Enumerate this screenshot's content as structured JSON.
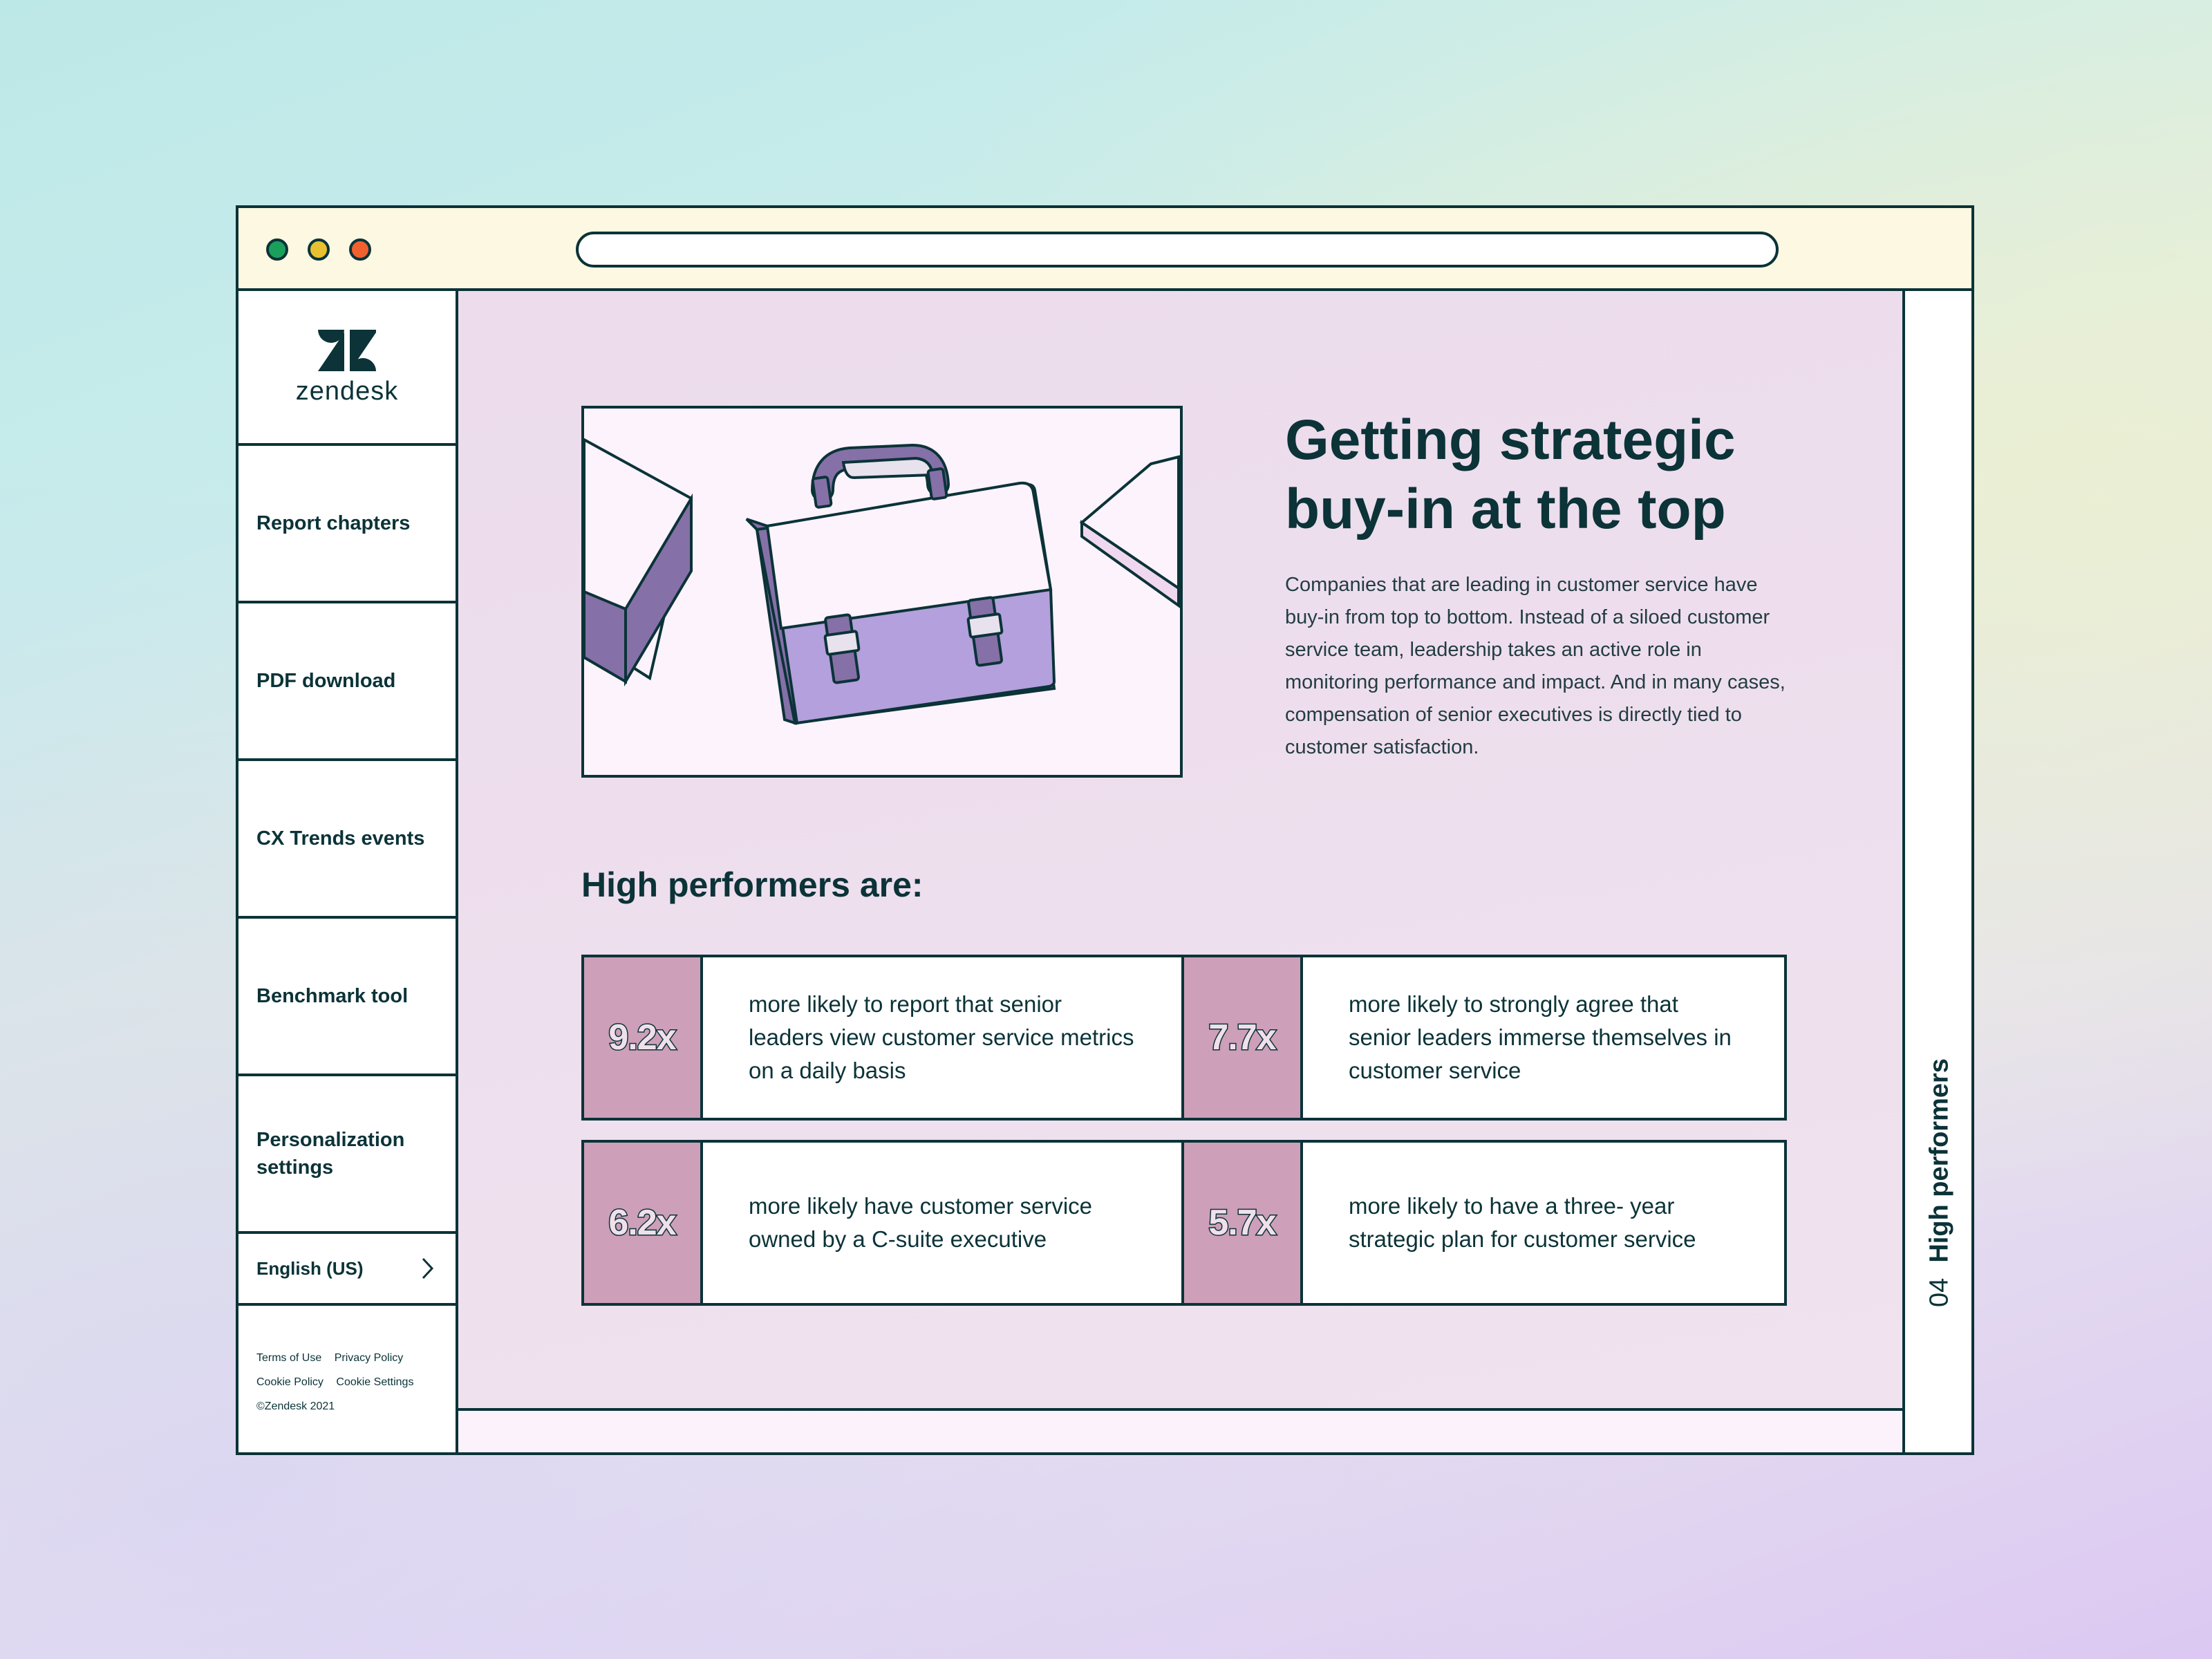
{
  "brand": {
    "name": "zendesk"
  },
  "sidebar": {
    "items": [
      {
        "label": "Report chapters"
      },
      {
        "label": "PDF download"
      },
      {
        "label": "CX Trends events"
      },
      {
        "label": "Benchmark tool"
      },
      {
        "label": "Personalization settings"
      }
    ],
    "language": "English (US)",
    "footer": {
      "terms": "Terms of Use",
      "privacy": "Privacy Policy",
      "cookie_policy": "Cookie Policy",
      "cookie_settings": "Cookie Settings",
      "copyright": "©Zendesk 2021"
    }
  },
  "main": {
    "headline": "Getting strategic buy-in at the top",
    "body": "Companies that are leading in customer service have buy-in from top to bottom. Instead of a siloed customer service team, leadership takes an active role in monitoring performance and impact. And in many cases, compensation of senior executives is directly tied to customer satisfaction.",
    "section_title": "High performers are:",
    "stats": [
      {
        "value": "9.2x",
        "text": "more likely to report that senior leaders view customer service metrics on a daily basis"
      },
      {
        "value": "7.7x",
        "text": "more likely to strongly agree that senior leaders immerse themselves in customer service"
      },
      {
        "value": "6.2x",
        "text": "more likely have customer service owned by a C-suite executive"
      },
      {
        "value": "5.7x",
        "text": "more likely to have a three- year strategic plan for customer service"
      }
    ]
  },
  "chapter": {
    "number": "04",
    "title": "High performers"
  },
  "colors": {
    "ink": "#0b3338",
    "content_bg": "#ecdcec",
    "stat_bg": "#cd9fb9",
    "titlebar_bg": "#fdf8e1",
    "briefcase_purple": "#b3a0dc"
  }
}
